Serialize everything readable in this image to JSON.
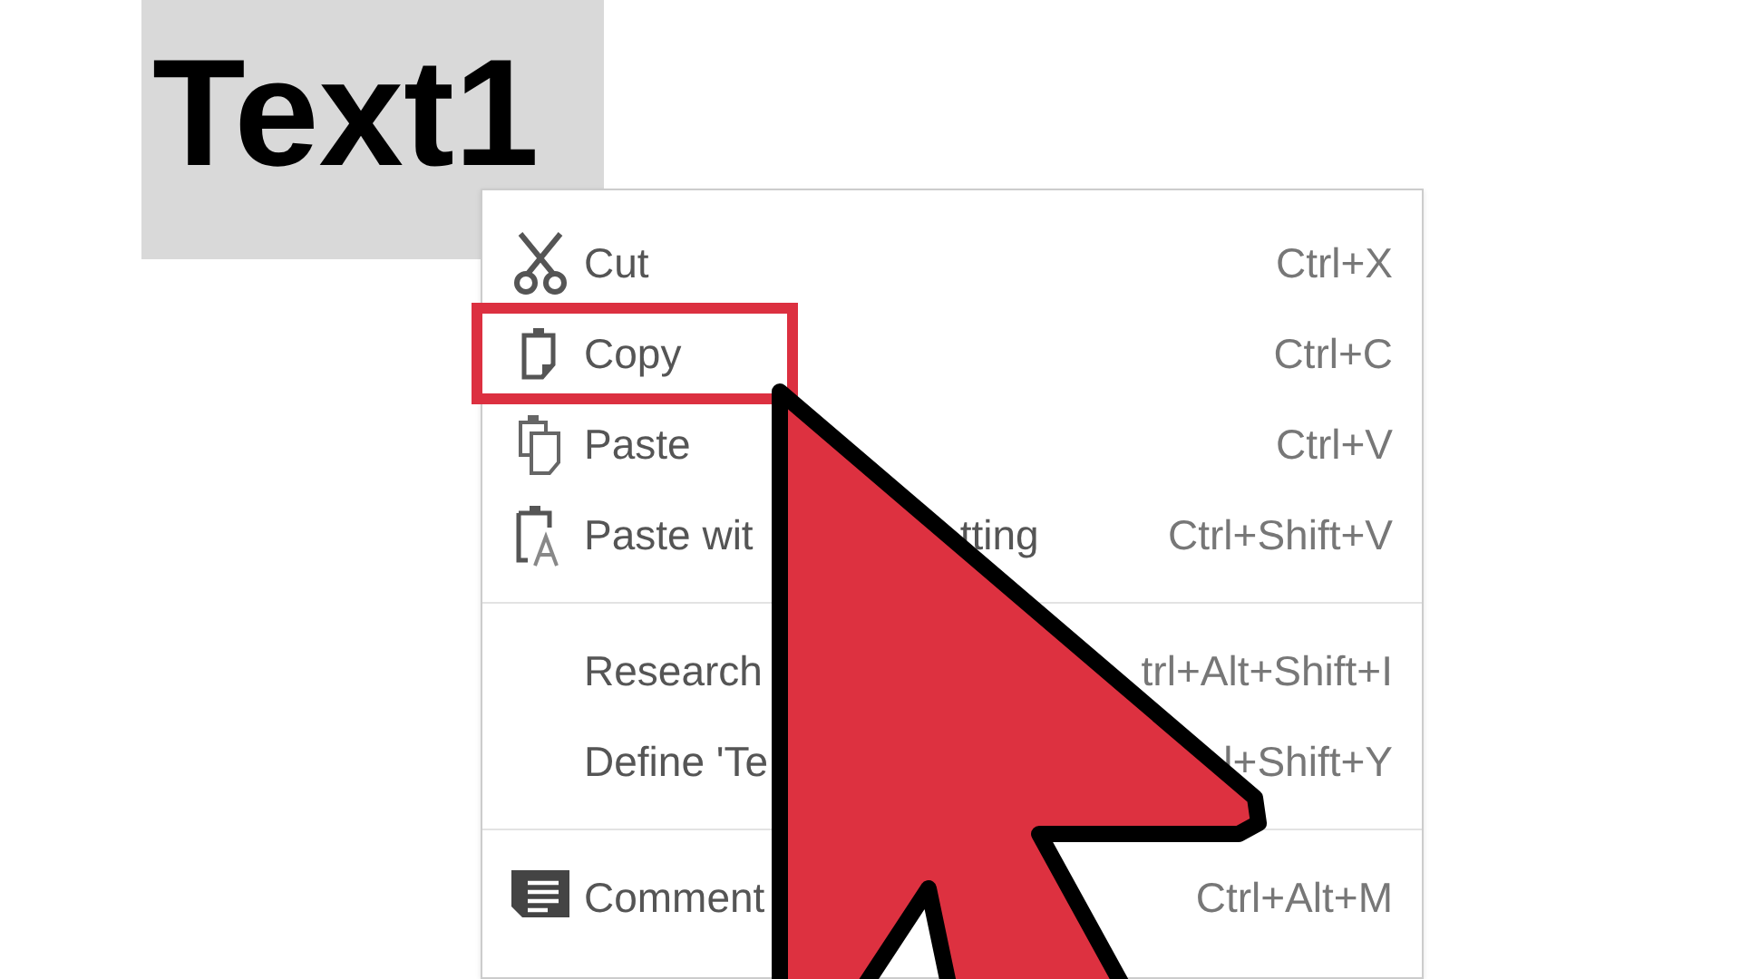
{
  "document": {
    "selected_text": "Text1"
  },
  "context_menu": {
    "items": [
      {
        "kind": "item",
        "label": "Cut",
        "shortcut": "Ctrl+X",
        "selected": false
      },
      {
        "kind": "item",
        "label": "Copy",
        "shortcut": "Ctrl+C",
        "selected": true
      },
      {
        "kind": "item",
        "label": "Paste",
        "shortcut": "Ctrl+V",
        "selected": false
      },
      {
        "kind": "item",
        "label": "Paste wit",
        "label_tail": "tting",
        "shortcut": "Ctrl+Shift+V",
        "selected": false
      },
      {
        "kind": "separator"
      },
      {
        "kind": "item",
        "label": "Research",
        "shortcut": "trl+Alt+Shift+I",
        "selected": false
      },
      {
        "kind": "item",
        "label": "Define 'Te",
        "shortcut": "l+Shift+Y",
        "selected": false
      },
      {
        "kind": "separator"
      },
      {
        "kind": "item",
        "label": "Comment",
        "shortcut": "Ctrl+Alt+M",
        "selected": false
      }
    ]
  }
}
